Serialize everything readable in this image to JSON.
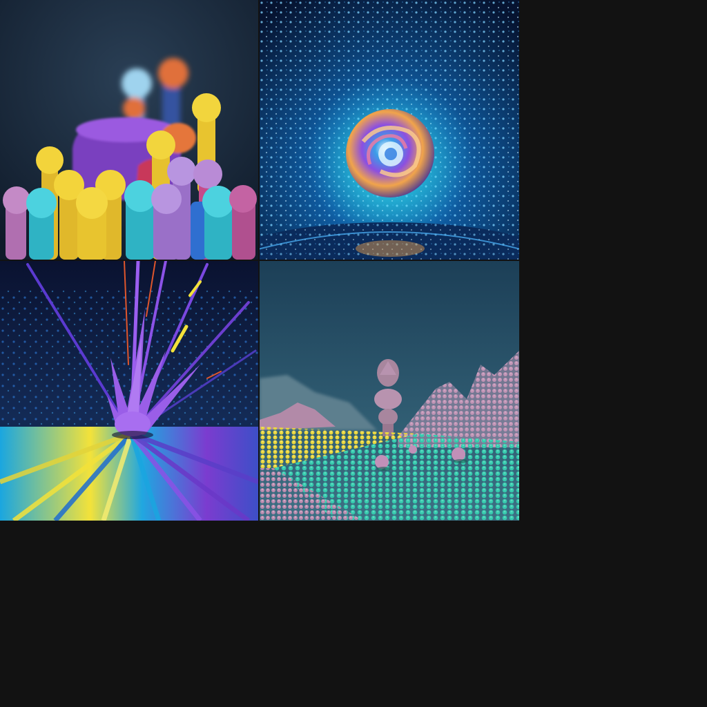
{
  "page": {
    "background": "#121212"
  },
  "tiles": [
    {
      "subject": "clay-pegs-and-balls",
      "palette": [
        "#1e2f44",
        "#f1d13a",
        "#a57bd6",
        "#36c3d3",
        "#e9733a",
        "#7a3fbf"
      ]
    },
    {
      "subject": "swirling-sphere-over-particle-field",
      "palette": [
        "#07162e",
        "#2e8fe0",
        "#8a4fe0",
        "#f0a24a",
        "#1fc7d8"
      ]
    },
    {
      "subject": "purple-spiky-burst-on-striped-floor",
      "palette": [
        "#0b1733",
        "#8b52e6",
        "#f3e23a",
        "#22aee0",
        "#7b3ccf"
      ]
    },
    {
      "subject": "clay-landscape-with-stone-stack",
      "palette": [
        "#2c5366",
        "#c99fbf",
        "#e2d23a",
        "#2db79e",
        "#a8869e"
      ]
    }
  ]
}
